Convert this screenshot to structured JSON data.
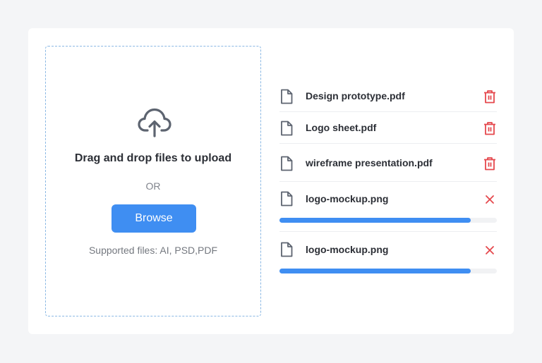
{
  "dropzone": {
    "title": "Drag and drop files to upload",
    "or_text": "OR",
    "browse_label": "Browse",
    "supported_text": "Supported files: AI, PSD,PDF",
    "icon": "cloud-upload-icon"
  },
  "files": [
    {
      "name": "Design prototype.pdf",
      "status": "uploaded",
      "action_icon": "trash-icon"
    },
    {
      "name": "Logo sheet.pdf",
      "status": "uploaded",
      "action_icon": "trash-icon"
    },
    {
      "name": "wireframe presentation.pdf",
      "status": "uploaded",
      "action_icon": "trash-icon"
    },
    {
      "name": "logo-mockup.png",
      "status": "uploading",
      "progress": 0.88,
      "action_icon": "close-icon"
    },
    {
      "name": "logo-mockup.png",
      "status": "uploading",
      "progress": 0.88,
      "action_icon": "close-icon"
    }
  ],
  "colors": {
    "accent": "#3f8ef2",
    "danger": "#e5484d",
    "dropzone_border": "#8ab8e4",
    "background": "#f4f5f7"
  }
}
